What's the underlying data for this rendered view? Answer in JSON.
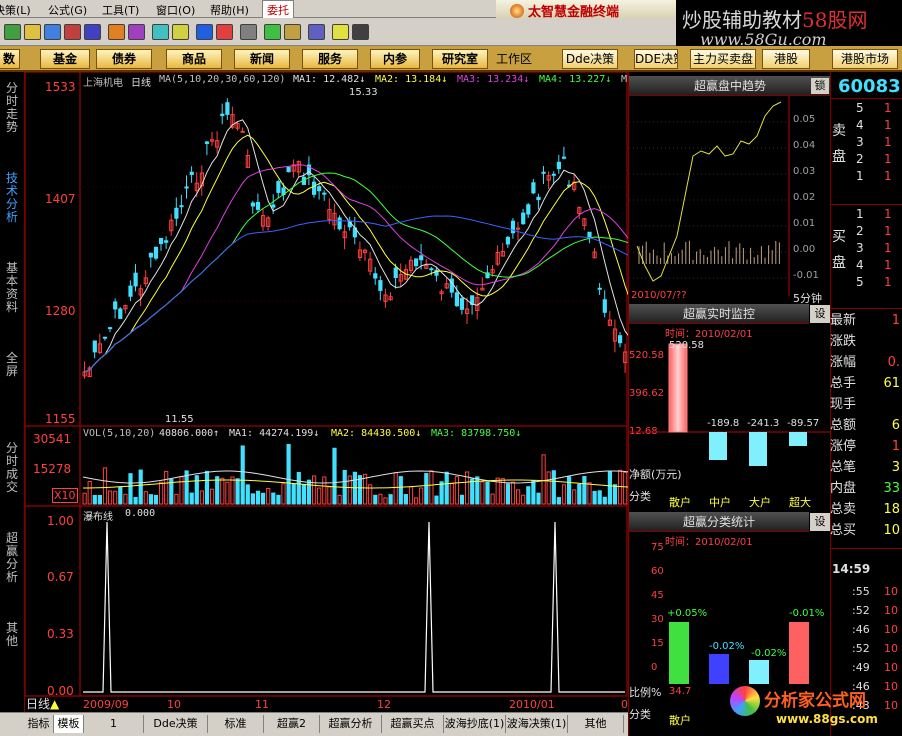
{
  "menu": {
    "items": [
      "决策(L)",
      "公式(G)",
      "工具(T)",
      "窗口(O)",
      "帮助(H)"
    ],
    "entrust": "委托",
    "brand": "太智慧金融终端"
  },
  "watermark": {
    "title_a": "炒股辅助教材",
    "title_b": "58股网",
    "url": "www.58Gu.com"
  },
  "funcbar": {
    "buttons": [
      "数",
      "基金",
      "债券",
      "商品",
      "新闻",
      "服务",
      "内参",
      "研究室"
    ],
    "workarea": "工作区",
    "right_buttons": [
      "Dde决策",
      "DDE决策",
      "主力买卖盘",
      "港股",
      "港股市场"
    ]
  },
  "sidetabs": [
    "分时走势",
    "技术分析",
    "基本资料",
    "全屏",
    "分时成交",
    "超赢分析",
    "其他"
  ],
  "chart": {
    "stock_name": "上海机电",
    "period": "日线",
    "ma_header": "MA(5,10,20,30,60,120)",
    "ma1": "MA1: 12.482↓",
    "ma2": "MA2: 13.184↓",
    "ma3": "MA3: 13.234↓",
    "ma4": "MA4: 13.227↓",
    "ma5": "M",
    "price_axis": [
      "1533",
      "1407",
      "1280",
      "1155"
    ],
    "high_label": "15.33",
    "low_label": "11.55",
    "vol_header": "VOL(5,10,20)",
    "vol_value": "40806.000↑",
    "vol_ma1": "MA1: 44274.199↓",
    "vol_ma2": "MA2: 84430.500↓",
    "vol_ma3": "MA3: 83798.750↓",
    "vol_axis": [
      "30541",
      "15278"
    ],
    "vol_unit": "X10",
    "ind_name": "瀑布线",
    "ind_value": "0.000",
    "ind_axis": [
      "1.00",
      "0.67",
      "0.33",
      "0.00"
    ],
    "date_labels": [
      "2009/09",
      "10",
      "11",
      "12",
      "2010/01",
      "02"
    ]
  },
  "bottomtabs": {
    "period": "日线",
    "tabs": [
      "指标",
      "模板",
      "1",
      "Dde决策",
      "标准",
      "超赢2",
      "超赢分析",
      "超赢买点",
      "波海抄底(1)",
      "波海决策(1)",
      "其他"
    ]
  },
  "right": {
    "trend_title": "超赢盘中趋势",
    "trend_btn": "锁",
    "trend_axis": [
      "0.05",
      "0.04",
      "0.03",
      "0.02",
      "0.01",
      "0.00",
      "-0.01"
    ],
    "trend_date": "2010/07/??",
    "trend_period": "5分钟",
    "monitor_title": "超赢实时监控",
    "monitor_btn": "设",
    "monitor_time": "时间：2010/02/01",
    "monitor_axis": [
      "520.58",
      "396.62",
      "12.68"
    ],
    "monitor_values": [
      "520.58",
      "-189.8",
      "-241.3",
      "-89.57"
    ],
    "net_label": "净额(万元)",
    "cat_label": "分类",
    "cats": [
      "散户",
      "中户",
      "大户",
      "超大"
    ],
    "stat_title": "超赢分类统计",
    "stat_btn": "设",
    "stat_time": "时间：2010/02/01",
    "stat_axis": [
      "75",
      "60",
      "45",
      "30",
      "15",
      "0"
    ],
    "stat_values": [
      "+0.05%",
      "-0.02%",
      "-0.02%",
      "-0.01%"
    ],
    "ratio_label": "比例%",
    "ratio_value": "34.7",
    "cat_label2": "分类",
    "cat_first2": "散户"
  },
  "quote": {
    "code": "60083",
    "sell_label": "卖盘",
    "sell_idx": [
      "5",
      "4",
      "3",
      "2",
      "1"
    ],
    "sell_vals": [
      "1",
      "1",
      "1",
      "1",
      "1"
    ],
    "buy_label": "买盘",
    "buy_idx": [
      "1",
      "2",
      "3",
      "4",
      "5"
    ],
    "buy_vals": [
      "1",
      "1",
      "1",
      "1",
      "1"
    ],
    "labels": [
      "最新",
      "涨跌",
      "涨幅",
      "总手",
      "现手",
      "总额",
      "涨停",
      "总笔",
      "内盘",
      "总卖",
      "总买"
    ],
    "values": [
      "1",
      "",
      "0.",
      "61",
      "",
      "6",
      "1",
      "3",
      "33",
      "18",
      "10"
    ],
    "ticks_time": "14:59",
    "ticks": [
      ":55",
      ":52",
      ":46",
      ":52",
      ":49",
      ":46",
      ":43"
    ],
    "ticks_val": [
      "10",
      "10",
      "10",
      "10",
      "10",
      "10",
      "10"
    ]
  },
  "logo": {
    "text": "分析家公式网",
    "url": "www.88gs.com"
  },
  "colors": {
    "up": "#ff4040",
    "down": "#40e0ff",
    "axis": "#c00000"
  }
}
